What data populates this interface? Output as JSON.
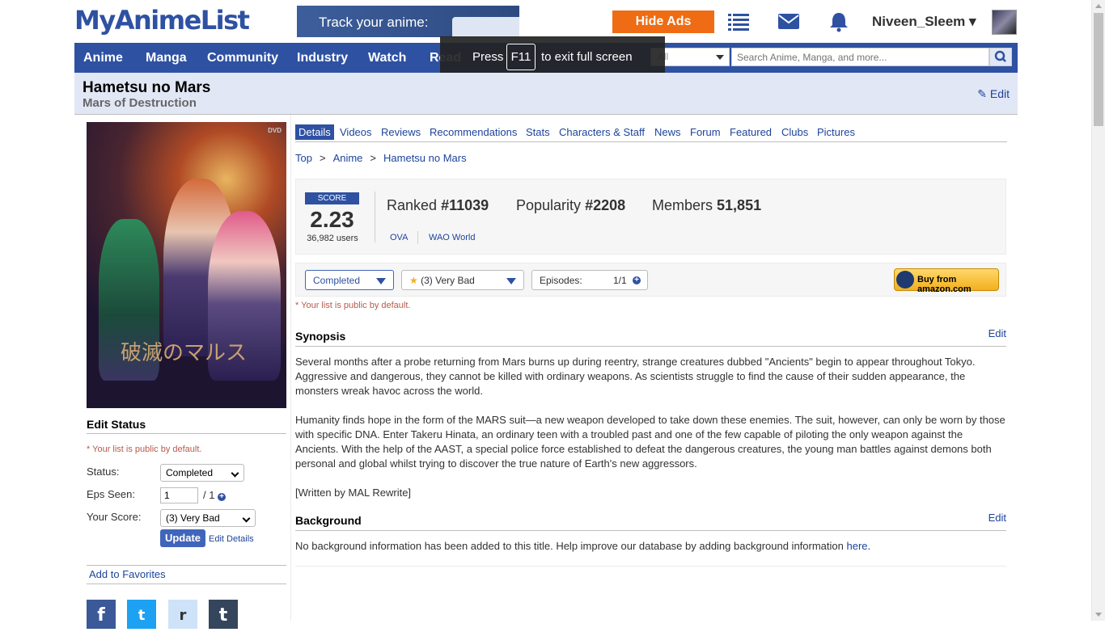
{
  "header": {
    "logo": "MyAnimeList",
    "banner_text": "Track your anime:",
    "hide_ads": "Hide Ads",
    "username": "Niveen_Sleem",
    "username_caret": "▾"
  },
  "nav": {
    "items": [
      "Anime",
      "Manga",
      "Community",
      "Industry",
      "Watch",
      "Read"
    ],
    "search_category": "All",
    "search_placeholder": "Search Anime, Manga, and more..."
  },
  "fullscreen_notice": {
    "before": "Press",
    "key": "F11",
    "after": "to exit full screen"
  },
  "title": {
    "main": "Hametsu no Mars",
    "english": "Mars of Destruction",
    "edit": "Edit"
  },
  "cover": {
    "dvd": "DVD",
    "logo_text": "破滅のマルス"
  },
  "edit_status": {
    "heading": "Edit Status",
    "public_note": "* Your list is public by default.",
    "status_label": "Status:",
    "status_value": "Completed",
    "eps_label": "Eps Seen:",
    "eps_value": "1",
    "eps_total": "/ 1",
    "score_label": "Your Score:",
    "score_value": "(3) Very Bad",
    "update": "Update",
    "edit_details": "Edit Details",
    "add_favorites": "Add to Favorites"
  },
  "social": {
    "facebook": "f",
    "twitter": "t",
    "reddit": "r",
    "tumblr": "t"
  },
  "tabs": [
    "Details",
    "Videos",
    "Reviews",
    "Recommendations",
    "Stats",
    "Characters & Staff",
    "News",
    "Forum",
    "Featured",
    "Clubs",
    "Pictures"
  ],
  "breadcrumb": {
    "items": [
      "Top",
      "Anime",
      "Hametsu no Mars"
    ],
    "separator": ">"
  },
  "score": {
    "label": "SCORE",
    "value": "2.23",
    "users": "36,982 users",
    "ranked_label": "Ranked",
    "ranked_value": "#11039",
    "popularity_label": "Popularity",
    "popularity_value": "#2208",
    "members_label": "Members",
    "members_value": "51,851",
    "type": "OVA",
    "studio": "WAO World"
  },
  "list_bar": {
    "status": "Completed",
    "score": "(3) Very Bad",
    "episodes_label": "Episodes:",
    "episodes_value": "1/1",
    "amazon": "Buy from amazon.com",
    "public_note": "* Your list is public by default."
  },
  "synopsis": {
    "heading": "Synopsis",
    "edit": "Edit",
    "p1": "Several months after a probe returning from Mars burns up during reentry, strange creatures dubbed \"Ancients\" begin to appear throughout Tokyo. Aggressive and dangerous, they cannot be killed with ordinary weapons. As scientists struggle to find the cause of their sudden appearance, the monsters wreak havoc across the world.",
    "p2": "Humanity finds hope in the form of the MARS suit—a new weapon developed to take down these enemies. The suit, however, can only be worn by those with specific DNA. Enter Takeru Hinata, an ordinary teen with a troubled past and one of the few capable of piloting the only weapon against the Ancients. With the help of the AAST, a special police force established to defeat the dangerous creatures, the young man battles against demons both personal and global whilst trying to discover the true nature of Earth's new aggressors.",
    "p3": "[Written by MAL Rewrite]"
  },
  "background": {
    "heading": "Background",
    "edit": "Edit",
    "text": "No background information has been added to this title. Help improve our database by adding background information ",
    "link": "here",
    "end": "."
  },
  "colors": {
    "brand": "#2e51a2",
    "hide_ads": "#ef6c14",
    "title_bg": "#e1e7f5"
  }
}
